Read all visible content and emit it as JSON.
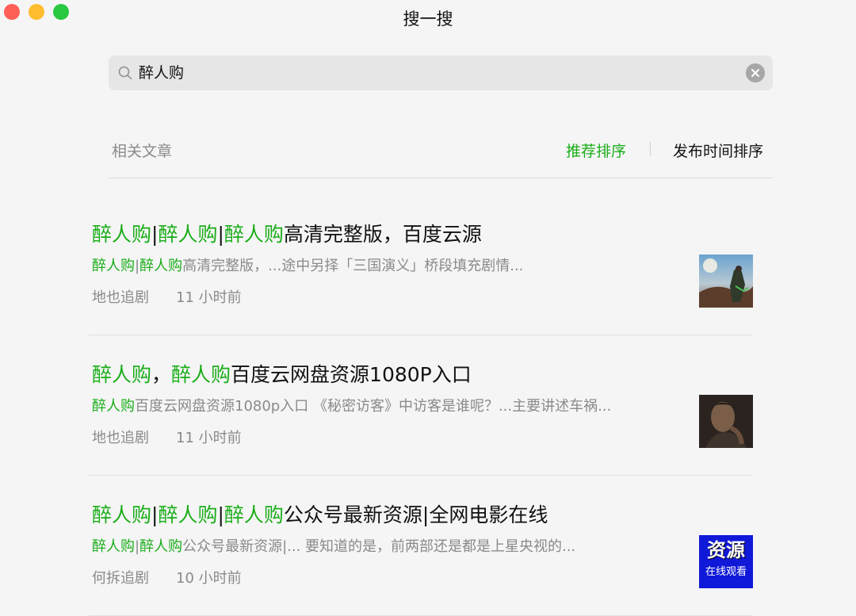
{
  "window": {
    "title": "搜一搜"
  },
  "search": {
    "query": "醉人购"
  },
  "filter": {
    "label": "相关文章",
    "sort_recommended": "推荐排序",
    "sort_time": "发布时间排序"
  },
  "results": [
    {
      "title_parts": [
        {
          "text": "醉人购",
          "hl": true
        },
        {
          "text": "|",
          "hl": false
        },
        {
          "text": "醉人购",
          "hl": true
        },
        {
          "text": "|",
          "hl": false
        },
        {
          "text": "醉人购",
          "hl": true
        },
        {
          "text": "高清完整版，百度云源",
          "hl": false
        }
      ],
      "snippet_parts": [
        {
          "text": "醉人购",
          "hl": true
        },
        {
          "text": "|",
          "hl": false
        },
        {
          "text": "醉人购",
          "hl": true
        },
        {
          "text": "高清完整版，...途中另择「三国演义」桥段填充剧情...",
          "hl": false
        }
      ],
      "source": "地也追剧",
      "time": "11 小时前",
      "thumbnail": "scene-landscape"
    },
    {
      "title_parts": [
        {
          "text": "醉人购",
          "hl": true
        },
        {
          "text": "，",
          "hl": false
        },
        {
          "text": "醉人购",
          "hl": true
        },
        {
          "text": "百度云网盘资源1080P入口",
          "hl": false
        }
      ],
      "snippet_parts": [
        {
          "text": "醉人购",
          "hl": true
        },
        {
          "text": "百度云网盘资源1080p入口 《秘密访客》中访客是谁呢？...主要讲述车祸...",
          "hl": false
        }
      ],
      "source": "地也追剧",
      "time": "11 小时前",
      "thumbnail": "portrait-dark"
    },
    {
      "title_parts": [
        {
          "text": "醉人购",
          "hl": true
        },
        {
          "text": "|",
          "hl": false
        },
        {
          "text": "醉人购",
          "hl": true
        },
        {
          "text": "|",
          "hl": false
        },
        {
          "text": "醉人购",
          "hl": true
        },
        {
          "text": "公众号最新资源|全网电影在线",
          "hl": false
        }
      ],
      "snippet_parts": [
        {
          "text": "醉人购",
          "hl": true
        },
        {
          "text": "|",
          "hl": false
        },
        {
          "text": "醉人购",
          "hl": true
        },
        {
          "text": "公众号最新资源|... 要知道的是，前两部还是都是上星央视的...",
          "hl": false
        }
      ],
      "source": "何拆追剧",
      "time": "10 小时前",
      "thumbnail": "resource-badge",
      "thumb_text_top": "资源",
      "thumb_text_bottom": "在线观看"
    }
  ],
  "colors": {
    "highlight": "#1aad19",
    "thumb_badge_bg": "#1019d8"
  }
}
